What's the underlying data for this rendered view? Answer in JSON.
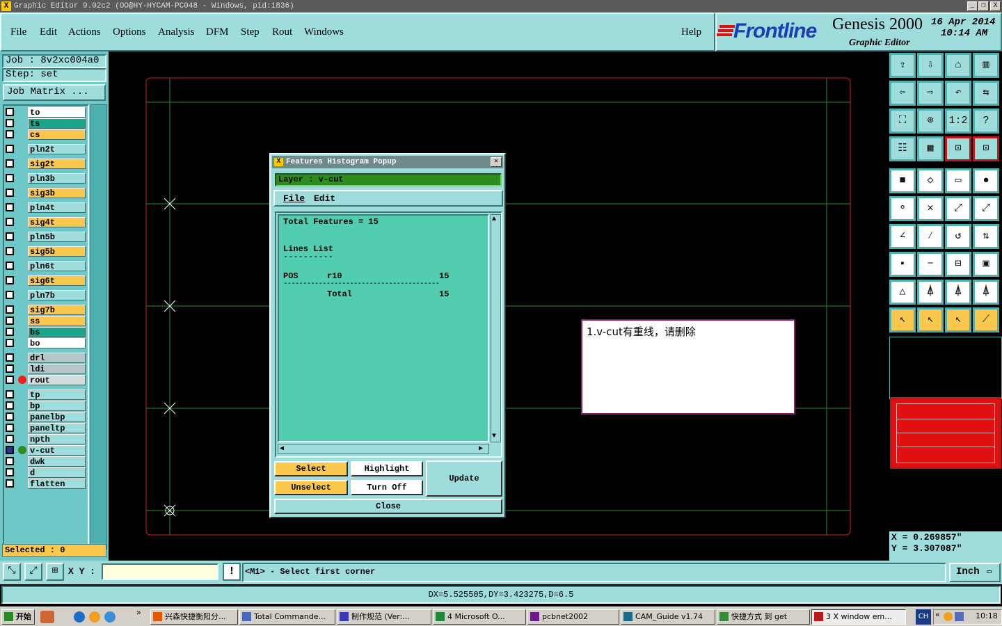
{
  "window": {
    "title": "Graphic Editor 9.02c2  (OO@HY-HYCAM-PC048 - Windows, pid:1836)",
    "min_label": "_",
    "max_label": "❐",
    "close_label": "X"
  },
  "menu": {
    "items": [
      "File",
      "Edit",
      "Actions",
      "Options",
      "Analysis",
      "DFM",
      "Step",
      "Rout",
      "Windows"
    ],
    "help": "Help"
  },
  "brand": {
    "logo": "Frontline",
    "product": "Genesis 2000",
    "subtitle": "Graphic Editor",
    "date": "16 Apr 2014",
    "time": "10:14 AM"
  },
  "job": {
    "job_label": "Job : 8v2xc004a0",
    "step_label": "Step: set",
    "matrix_button": "Job Matrix ..."
  },
  "layers": [
    {
      "name": "to",
      "color": "#ffffff",
      "dot": ""
    },
    {
      "name": "ts",
      "color": "#1aa58b",
      "dot": ""
    },
    {
      "name": "cs",
      "color": "#fbc84e",
      "dot": ""
    },
    {
      "name": "pln2t",
      "color": "#9fdcdc",
      "dot": ""
    },
    {
      "name": "sig2t",
      "color": "#fbc84e",
      "dot": ""
    },
    {
      "name": "pln3b",
      "color": "#9fdcdc",
      "dot": ""
    },
    {
      "name": "sig3b",
      "color": "#fbc84e",
      "dot": ""
    },
    {
      "name": "pln4t",
      "color": "#9fdcdc",
      "dot": ""
    },
    {
      "name": "sig4t",
      "color": "#fbc84e",
      "dot": ""
    },
    {
      "name": "pln5b",
      "color": "#9fdcdc",
      "dot": ""
    },
    {
      "name": "sig5b",
      "color": "#fbc84e",
      "dot": ""
    },
    {
      "name": "pln6t",
      "color": "#9fdcdc",
      "dot": ""
    },
    {
      "name": "sig6t",
      "color": "#fbc84e",
      "dot": ""
    },
    {
      "name": "pln7b",
      "color": "#9fdcdc",
      "dot": ""
    },
    {
      "name": "sig7b",
      "color": "#fbc84e",
      "dot": ""
    },
    {
      "name": "ss",
      "color": "#fbc84e",
      "dot": ""
    },
    {
      "name": "bs",
      "color": "#1aa58b",
      "dot": ""
    },
    {
      "name": "bo",
      "color": "#ffffff",
      "dot": ""
    },
    {
      "name": "drl",
      "color": "#b4c6c8",
      "dot": ""
    },
    {
      "name": "ldi",
      "color": "#b4c6c8",
      "dot": ""
    },
    {
      "name": "rout",
      "color": "#d4dcdc",
      "dot": "#ff1a1a"
    },
    {
      "name": "tp",
      "color": "#9fdcdc",
      "dot": ""
    },
    {
      "name": "bp",
      "color": "#9fdcdc",
      "dot": ""
    },
    {
      "name": "panelbp",
      "color": "#9fdcdc",
      "dot": ""
    },
    {
      "name": "paneltp",
      "color": "#9fdcdc",
      "dot": ""
    },
    {
      "name": "npth",
      "color": "#9fdcdc",
      "dot": ""
    },
    {
      "name": "v-cut",
      "color": "#9fdcdc",
      "dot": "#2e8b1e"
    },
    {
      "name": "dwk",
      "color": "#9fdcdc",
      "dot": ""
    },
    {
      "name": "d",
      "color": "#9fdcdc",
      "dot": ""
    },
    {
      "name": "flatten",
      "color": "#9fdcdc",
      "dot": ""
    }
  ],
  "selected": "Selected : 0",
  "popup": {
    "title": "Features Histogram Popup",
    "layer": "Layer :  v-cut",
    "menu_file": "File",
    "menu_edit": "Edit",
    "total": "Total Features = 15",
    "list_title": "Lines List",
    "list_underline": "----------",
    "row_pos": "POS",
    "row_sym": "r10",
    "row_count": "15",
    "separator": "----------------------------------------",
    "total_label": "Total",
    "total_count": "15",
    "buttons": {
      "select": "Select",
      "unselect": "Unselect",
      "highlight": "Highlight",
      "turn_off": "Turn Off",
      "update": "Update",
      "close": "Close"
    }
  },
  "note": "1.v-cut有重线，请删除",
  "coords": {
    "x": "X = 0.269857\"",
    "y": "Y = 3.307087\""
  },
  "status": {
    "xy_label": "X Y :",
    "xy_value": "",
    "alert": "!",
    "message": "<M1> - Select first corner",
    "units": "Inch"
  },
  "measure": "DX=5.525505,DY=3.423275,D=6.5",
  "taskbar": {
    "start": "开始",
    "tasks": [
      "兴森快捷衡阳分...",
      "Total Commande...",
      "制作规范 (Ver:...",
      "4 Microsoft O...",
      "pcbnet2002",
      "CAM_Guide v1.74",
      "快捷方式 到 get",
      "3 X window em..."
    ],
    "lang": "CH",
    "clock": "10:18"
  }
}
